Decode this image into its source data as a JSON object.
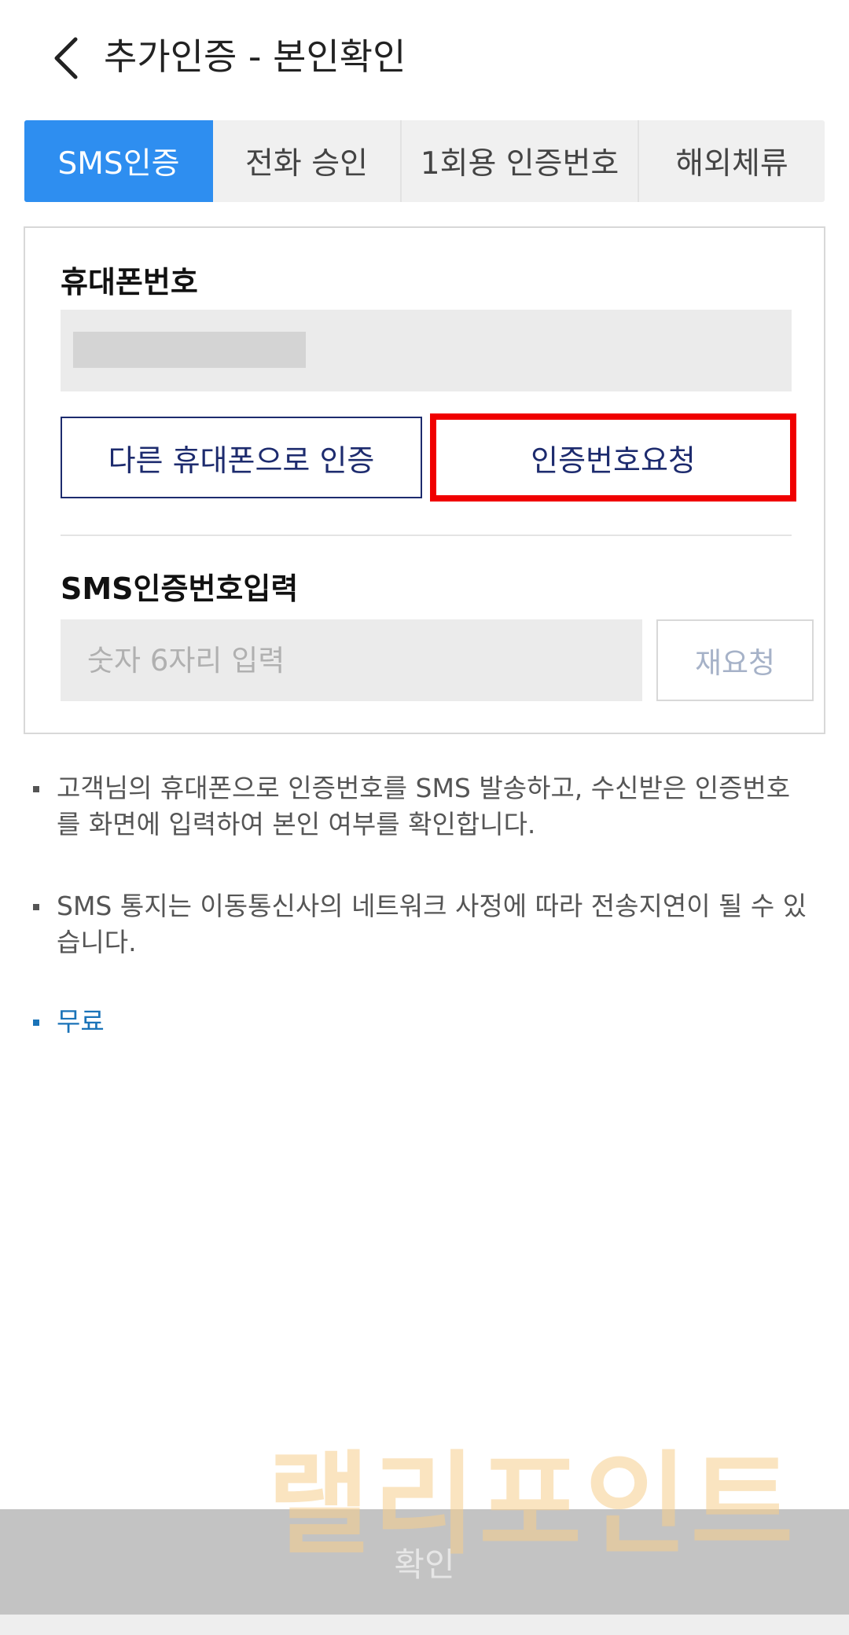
{
  "header": {
    "title": "추가인증 - 본인확인",
    "back_icon": "chevron-left-icon"
  },
  "tabs": [
    {
      "label": "SMS인증",
      "active": true
    },
    {
      "label": "전화 승인",
      "active": false
    },
    {
      "label": "1회용 인증번호",
      "active": false
    },
    {
      "label": "해외체류",
      "active": false
    }
  ],
  "form": {
    "phone_label": "휴대폰번호",
    "phone_value_masked": true,
    "other_phone_button": "다른 휴대폰으로 인증",
    "request_code_button": "인증번호요청",
    "code_label": "SMS인증번호입력",
    "code_placeholder": "숫자 6자리 입력",
    "resend_button": "재요청"
  },
  "notes": [
    "고객님의 휴대폰으로 인증번호를 SMS 발송하고, 수신받은 인증번호를 화면에 입력하여 본인 여부를 확인합니다.",
    "SMS 통지는 이동통신사의 네트워크 사정에 따라 전송지연이 될 수 있습니다.",
    "무료"
  ],
  "watermark": "랠리포인트",
  "footer": {
    "confirm_button": "확인"
  },
  "colors": {
    "accent": "#2e8ef0",
    "navy": "#1d2b6e",
    "highlight": "#f00000",
    "free_text": "#1a73b8"
  }
}
